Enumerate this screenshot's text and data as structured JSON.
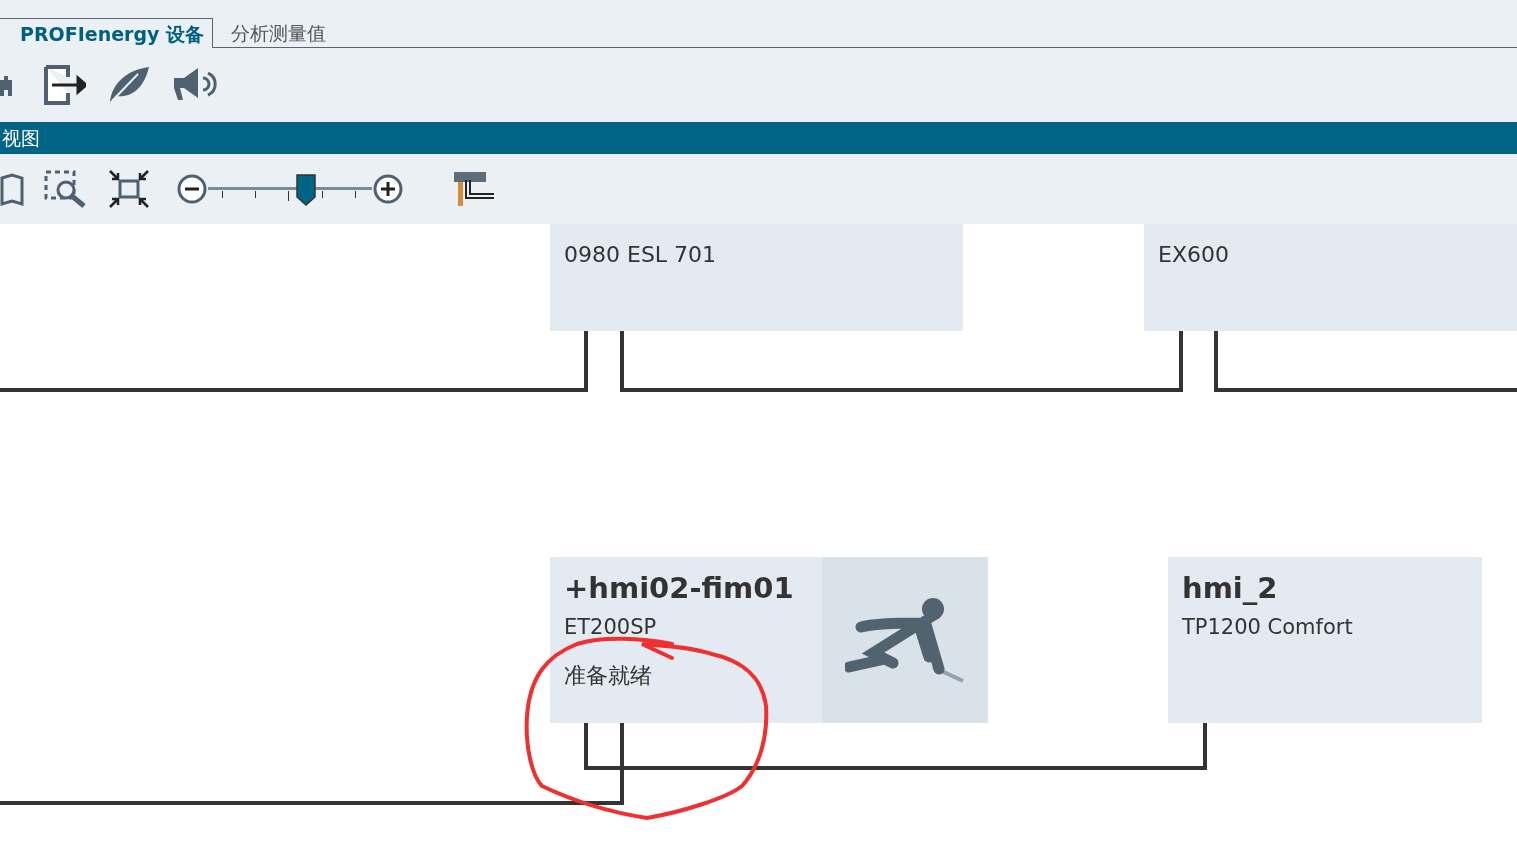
{
  "tabs": [
    {
      "label": "PROFIenergy 设备",
      "selected": true
    },
    {
      "label": "分析测量值",
      "selected": false
    }
  ],
  "panel": {
    "title": "视图"
  },
  "zoom": {
    "level": 0.6
  },
  "nodes": [
    {
      "kind": "cut",
      "label": "0980 ESL 701"
    },
    {
      "kind": "cut",
      "label": "EX600"
    },
    {
      "kind": "status",
      "title": "+hmi02-fim01",
      "type": "ET200SP",
      "status": "准备就绪"
    },
    {
      "kind": "plain",
      "title": "hmi_2",
      "type": "TP1200 Comfort"
    }
  ]
}
